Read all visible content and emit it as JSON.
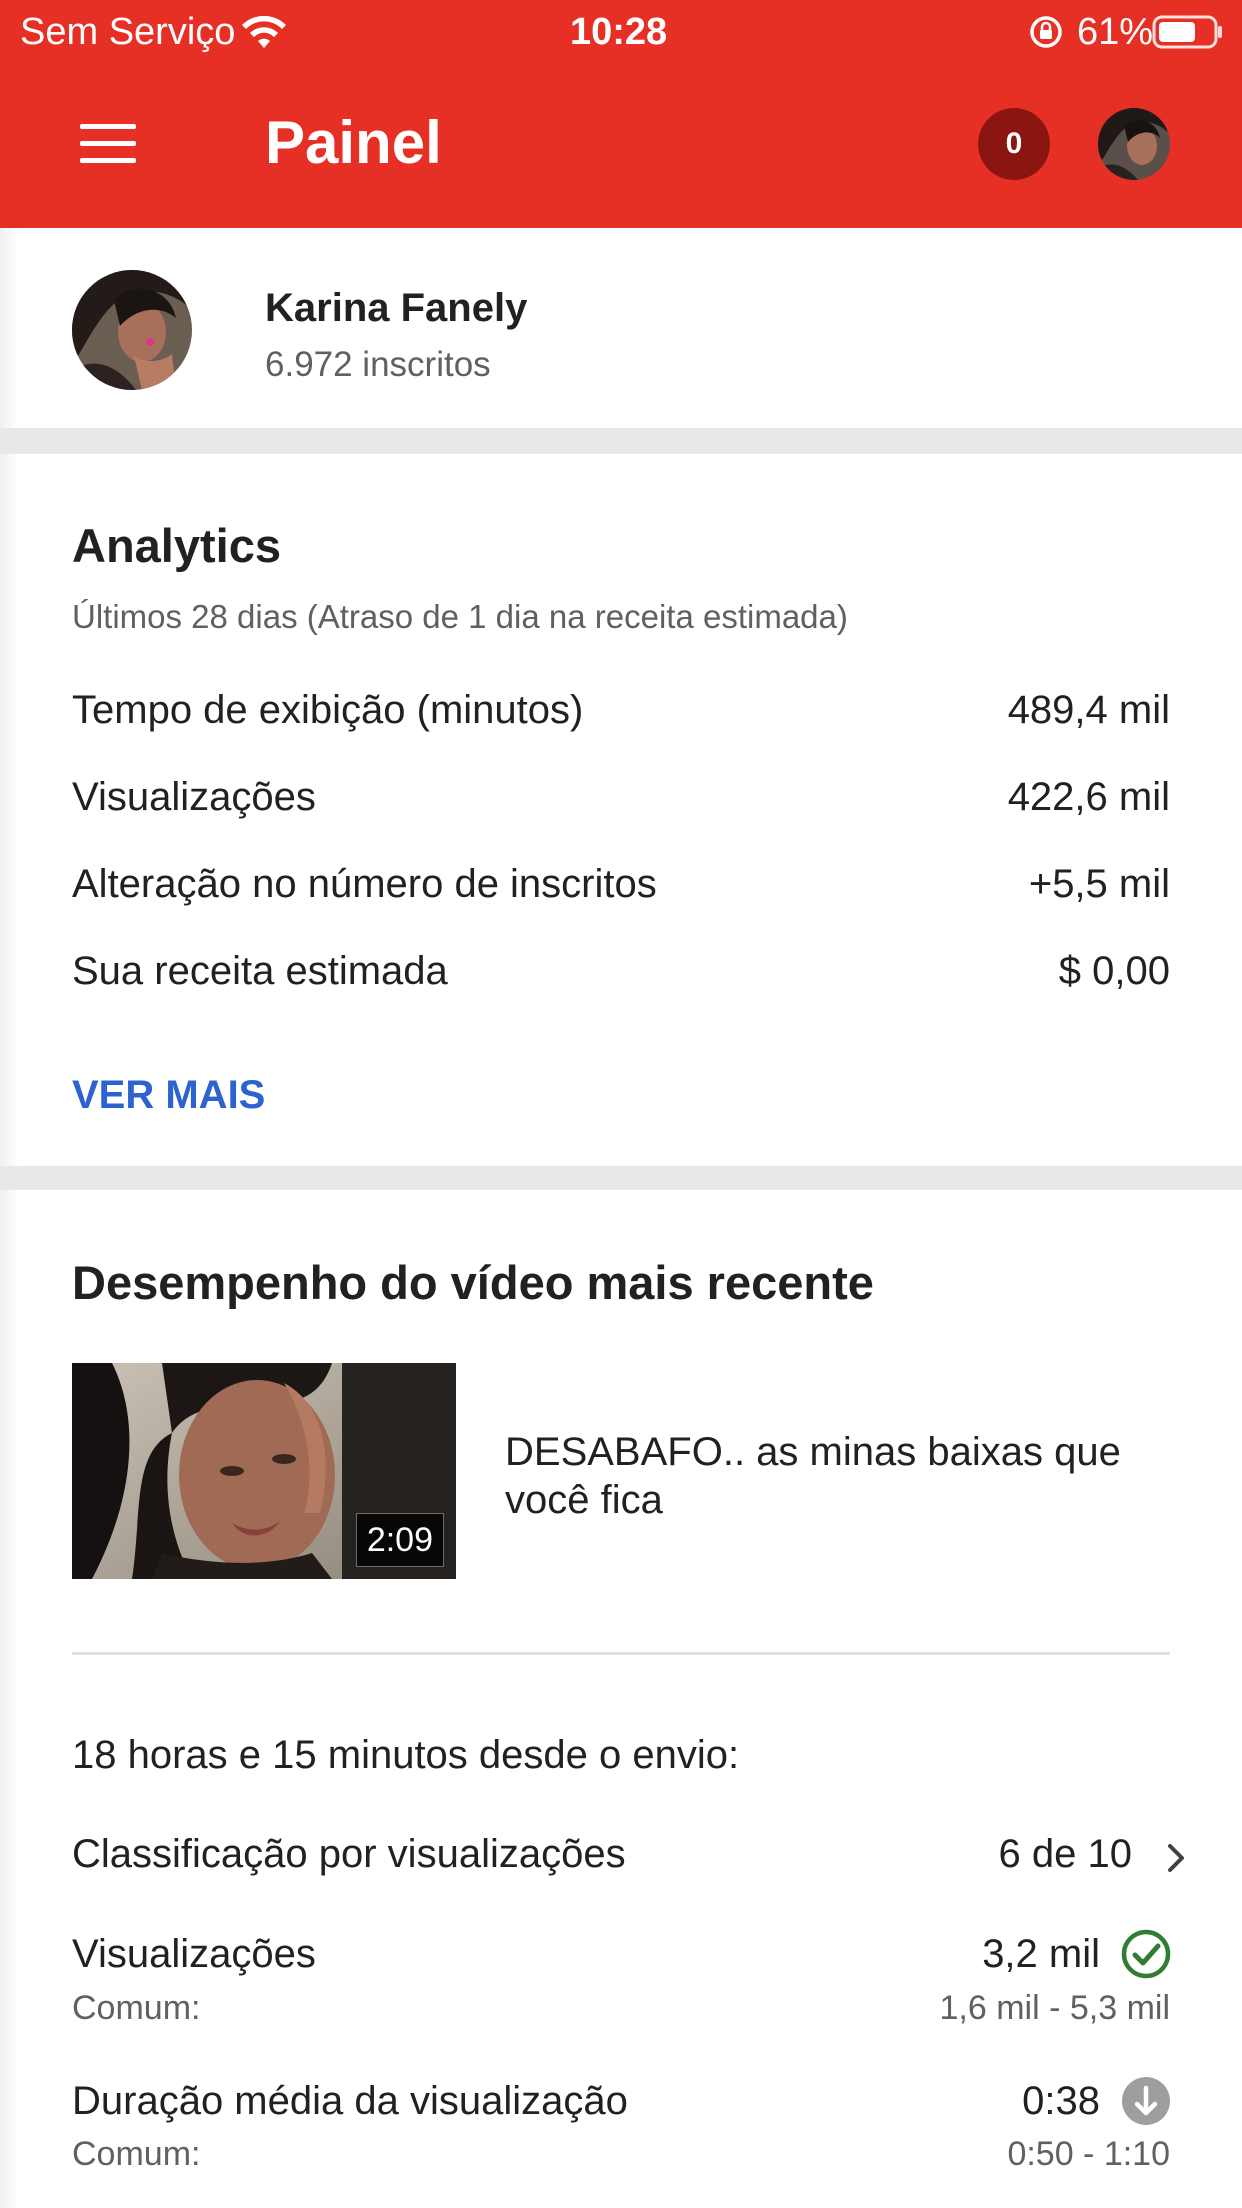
{
  "status_bar": {
    "carrier": "Sem Serviço",
    "time": "10:28",
    "battery": "61%",
    "wifi_icon": "wifi-icon",
    "rotation_lock_icon": "rotation-lock-icon",
    "battery_icon": "battery-icon"
  },
  "app_bar": {
    "title": "Painel",
    "notification_count": "0",
    "menu_icon": "hamburger-menu-icon",
    "background": "#e62f25"
  },
  "channel": {
    "name": "Karina Fanely",
    "subscribers": "6.972 inscritos"
  },
  "analytics": {
    "title": "Analytics",
    "period": "Últimos 28 dias (Atraso de 1 dia na receita estimada)",
    "rows": [
      {
        "label": "Tempo de exibição (minutos)",
        "value": "489,4 mil"
      },
      {
        "label": "Visualizações",
        "value": "422,6 mil"
      },
      {
        "label": "Alteração no número de inscritos",
        "value": "+5,5 mil"
      },
      {
        "label": "Sua receita estimada",
        "value": "$ 0,00"
      }
    ],
    "see_more": "VER MAIS",
    "link_color": "#2c63cf"
  },
  "recent_video": {
    "title": "Desempenho do vídeo mais recente",
    "video_title": "DESABAFO.. as minas baixas que você fica",
    "duration": "2:09",
    "since_upload": "18 horas e 15 minutos desde o envio:",
    "ranking": {
      "label": "Classificação por visualizações",
      "value": "6 de 10",
      "icon": "chevron-right-icon"
    },
    "views": {
      "label": "Visualizações",
      "value": "3,2 mil",
      "hint_label": "Comum:",
      "hint_value": "1,6 mil - 5,3 mil",
      "icon": "check-circle-icon",
      "icon_color": "#2e7d32"
    },
    "avg_duration": {
      "label": "Duração média da visualização",
      "value": "0:38",
      "hint_label": "Comum:",
      "hint_value": "0:50 - 1:10",
      "icon": "arrow-down-circle-icon",
      "icon_color": "#9e9e9e"
    }
  }
}
